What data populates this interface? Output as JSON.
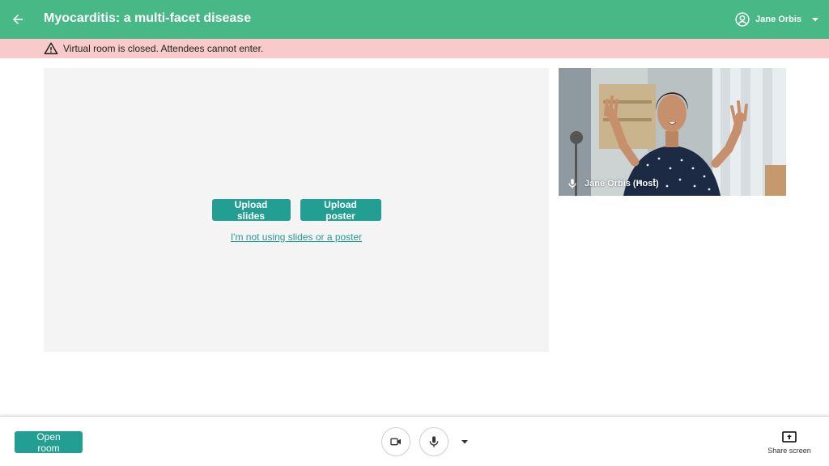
{
  "header": {
    "title": "Myocarditis: a multi-facet disease",
    "user_name": "Jane Orbis",
    "back_icon": "arrow-left-icon",
    "avatar_icon": "account-circle-icon",
    "caret_icon": "caret-down-icon"
  },
  "banner": {
    "icon": "warning-triangle-icon",
    "message": "Virtual room is closed. Attendees cannot enter."
  },
  "stage": {
    "upload_slides_label": "Upload slides",
    "upload_poster_label": "Upload poster",
    "no_slides_link": "I'm not using slides or a poster"
  },
  "video": {
    "participant_label": "Jane Orbis (Host)",
    "mic_icon": "microphone-icon"
  },
  "bottom_bar": {
    "open_room_label": "Open room",
    "camera_icon": "video-camera-icon",
    "mic_icon": "microphone-icon",
    "mic_options_icon": "caret-down-icon",
    "share_screen_label": "Share screen",
    "share_icon": "share-screen-icon"
  },
  "colors": {
    "header_bg": "#47b886",
    "banner_bg": "#f8caca",
    "accent": "#239e92",
    "stage_bg": "#f4f4f4"
  }
}
